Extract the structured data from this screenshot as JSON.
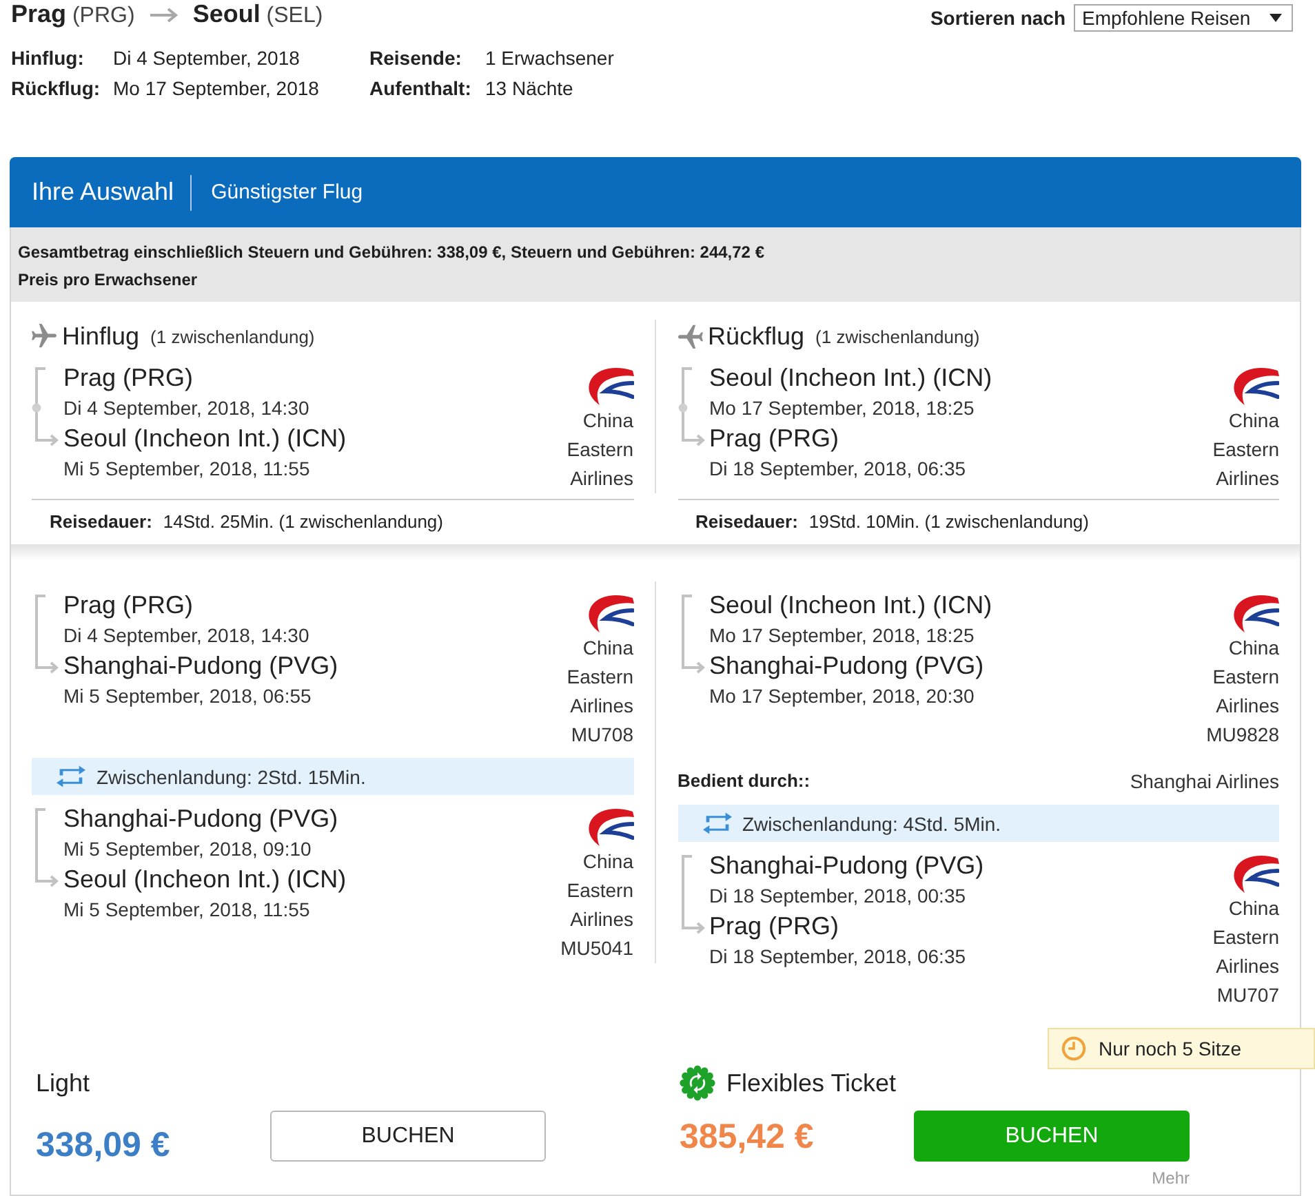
{
  "route": {
    "origin": "**Prag** (PRG)",
    "destination": "**Seoul** (SEL)"
  },
  "sort": {
    "label": "Sortieren nach",
    "value": "Empfohlene Reisen"
  },
  "trip_info": [
    {
      "label": "Hinflug:",
      "value": "Di 4 September, 2018"
    },
    {
      "label": "Reisende:",
      "value": "1 Erwachsener"
    },
    {
      "label": "Rückflug:",
      "value": "Mo 17 September, 2018"
    },
    {
      "label": "Aufenthalt:",
      "value": "13 Nächte"
    }
  ],
  "selection": {
    "title": "Ihre Auswahl",
    "subtitle": "Günstigster Flug"
  },
  "price_note": {
    "total": "Gesamtbetrag einschließlich Steuern und Gebühren: 338,09 €, Steuern und Gebühren: 244,72 €",
    "per_person": "Preis pro Erwachsener"
  },
  "summary": [
    {
      "kind": "outbound",
      "title": "Hinflug",
      "stops": "(1 zwischenlandung)",
      "departure": {
        "airport": "Prag (PRG)",
        "time": "Di 4 September, 2018, 14:30"
      },
      "arrival": {
        "airport": "Seoul (Incheon Int.) (ICN)",
        "time": "Mi 5 September, 2018, 11:55"
      },
      "airline": "China Eastern Airlines",
      "duration_label": "Reisedauer:",
      "duration": "14Std. 25Min. (1 zwischenlandung)"
    },
    {
      "kind": "return",
      "title": "Rückflug",
      "stops": "(1 zwischenlandung)",
      "departure": {
        "airport": "Seoul (Incheon Int.) (ICN)",
        "time": "Mo 17 September, 2018, 18:25"
      },
      "arrival": {
        "airport": "Prag (PRG)",
        "time": "Di 18 September, 2018, 06:35"
      },
      "airline": "China Eastern Airlines",
      "duration_label": "Reisedauer:",
      "duration": "19Std. 10Min. (1 zwischenlandung)"
    }
  ],
  "details": [
    {
      "items": [
        {
          "kind": "segment",
          "departure": {
            "airport": "Prag (PRG)",
            "time": "Di 4 September, 2018, 14:30"
          },
          "arrival": {
            "airport": "Shanghai-Pudong (PVG)",
            "time": "Mi 5 September, 2018, 06:55"
          },
          "airline": "China Eastern Airlines",
          "flight": "MU708"
        },
        {
          "kind": "layover",
          "text": "Zwischenlandung: 2Std. 15Min."
        },
        {
          "kind": "segment",
          "departure": {
            "airport": "Shanghai-Pudong (PVG)",
            "time": "Mi 5 September, 2018, 09:10"
          },
          "arrival": {
            "airport": "Seoul (Incheon Int.) (ICN)",
            "time": "Mi 5 September, 2018, 11:55"
          },
          "airline": "China Eastern Airlines",
          "flight": "MU5041"
        }
      ]
    },
    {
      "items": [
        {
          "kind": "segment",
          "departure": {
            "airport": "Seoul (Incheon Int.) (ICN)",
            "time": "Mo 17 September, 2018, 18:25"
          },
          "arrival": {
            "airport": "Shanghai-Pudong (PVG)",
            "time": "Mo 17 September, 2018, 20:30"
          },
          "airline": "China Eastern Airlines",
          "flight": "MU9828"
        },
        {
          "kind": "operated_by",
          "label": "Bedient durch::",
          "value": "Shanghai Airlines"
        },
        {
          "kind": "layover",
          "text": "Zwischenlandung: 4Std. 5Min."
        },
        {
          "kind": "segment",
          "departure": {
            "airport": "Shanghai-Pudong (PVG)",
            "time": "Di 18 September, 2018, 00:35"
          },
          "arrival": {
            "airport": "Prag (PRG)",
            "time": "Di 18 September, 2018, 06:35"
          },
          "airline": "China Eastern Airlines",
          "flight": "MU707"
        }
      ]
    }
  ],
  "fares": [
    {
      "kind": "standard",
      "name": "Light",
      "price": "338,09 €",
      "button": "BUCHEN"
    },
    {
      "kind": "flexible",
      "name": "Flexibles Ticket",
      "price": "385,42 €",
      "button": "BUCHEN",
      "more": "Mehr",
      "notice": "Nur noch 5 Sitze"
    }
  ]
}
